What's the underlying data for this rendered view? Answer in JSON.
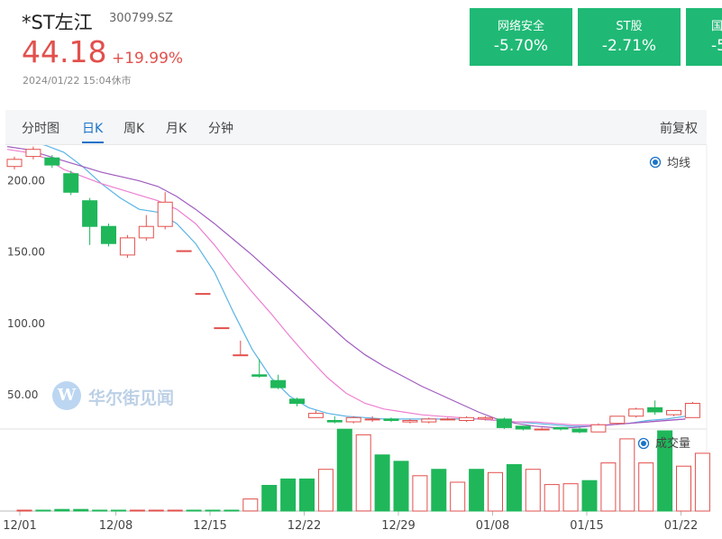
{
  "stock": {
    "name": "*ST左江",
    "code": "300799.SZ",
    "price": "44.18",
    "change": "+19.99%",
    "time": "2024/01/22 15:04休市"
  },
  "cards": [
    {
      "name": "网络安全",
      "value": "-5.70%"
    },
    {
      "name": "ST股",
      "value": "-2.71%"
    },
    {
      "name": "国",
      "value": "-5"
    }
  ],
  "tabs": [
    "分时图",
    "日K",
    "周K",
    "月K",
    "分钟"
  ],
  "active_tab": "日K",
  "adjust_label": "前复权",
  "watermark": {
    "logo": "W",
    "text": "华尔街见闻"
  },
  "colors": {
    "up": "#e2504c",
    "down": "#1fb75a",
    "card": "#1fb975",
    "accent": "#1a73c9",
    "ma1": "#5ab4e6",
    "ma2": "#ee7fd1",
    "ma3": "#a05cbf"
  },
  "chart_data": {
    "type": "candlestick",
    "legend": {
      "ma": "均线",
      "volume": "成交量"
    },
    "y_ticks": [
      "200.00",
      "150.00",
      "100.00",
      "50.00"
    ],
    "y_tick_values": [
      200,
      150,
      100,
      50
    ],
    "ylim": [
      26,
      225
    ],
    "x_ticks": [
      "12/01",
      "12/08",
      "12/15",
      "12/22",
      "12/29",
      "01/08",
      "01/15",
      "01/22"
    ],
    "x_tick_index": [
      0,
      5,
      10,
      15,
      20,
      25,
      30,
      35
    ],
    "candles": [
      {
        "o": 210,
        "c": 215,
        "h": 217,
        "l": 208
      },
      {
        "o": 217,
        "c": 222,
        "h": 224,
        "l": 215
      },
      {
        "o": 216,
        "c": 211,
        "h": 218,
        "l": 209
      },
      {
        "o": 205,
        "c": 192,
        "h": 207,
        "l": 190
      },
      {
        "o": 186,
        "c": 168,
        "h": 188,
        "l": 155
      },
      {
        "o": 168,
        "c": 156,
        "h": 170,
        "l": 154
      },
      {
        "o": 148,
        "c": 160,
        "h": 162,
        "l": 146
      },
      {
        "o": 160,
        "c": 168,
        "h": 176,
        "l": 158
      },
      {
        "o": 168,
        "c": 185,
        "h": 192,
        "l": 166
      },
      {
        "o": 151,
        "c": 151,
        "h": 151,
        "l": 151
      },
      {
        "o": 121,
        "c": 121,
        "h": 121,
        "l": 121
      },
      {
        "o": 97,
        "c": 97,
        "h": 97,
        "l": 97
      },
      {
        "o": 78,
        "c": 78,
        "h": 88,
        "l": 78
      },
      {
        "o": 64,
        "c": 63,
        "h": 75,
        "l": 62
      },
      {
        "o": 60,
        "c": 55,
        "h": 64,
        "l": 54
      },
      {
        "o": 47,
        "c": 44,
        "h": 48,
        "l": 42
      },
      {
        "o": 34,
        "c": 37,
        "h": 39,
        "l": 34
      },
      {
        "o": 32,
        "c": 31,
        "h": 35,
        "l": 30
      },
      {
        "o": 31,
        "c": 34,
        "h": 35,
        "l": 30
      },
      {
        "o": 33,
        "c": 33,
        "h": 35,
        "l": 31
      },
      {
        "o": 33,
        "c": 32,
        "h": 34,
        "l": 31
      },
      {
        "o": 31,
        "c": 32,
        "h": 33,
        "l": 30
      },
      {
        "o": 31,
        "c": 33,
        "h": 34,
        "l": 30
      },
      {
        "o": 33,
        "c": 33,
        "h": 34,
        "l": 32
      },
      {
        "o": 32,
        "c": 34,
        "h": 35,
        "l": 31
      },
      {
        "o": 33,
        "c": 34,
        "h": 35,
        "l": 32
      },
      {
        "o": 33,
        "c": 27,
        "h": 34,
        "l": 26
      },
      {
        "o": 28,
        "c": 26,
        "h": 28,
        "l": 25
      },
      {
        "o": 26,
        "c": 26,
        "h": 27,
        "l": 25
      },
      {
        "o": 27,
        "c": 26,
        "h": 27,
        "l": 25
      },
      {
        "o": 26,
        "c": 24,
        "h": 27,
        "l": 23
      },
      {
        "o": 24,
        "c": 29,
        "h": 30,
        "l": 24
      },
      {
        "o": 30,
        "c": 35,
        "h": 35,
        "l": 29
      },
      {
        "o": 35,
        "c": 40,
        "h": 41,
        "l": 34
      },
      {
        "o": 41,
        "c": 38,
        "h": 46,
        "l": 36
      },
      {
        "o": 36,
        "c": 39,
        "h": 39,
        "l": 35
      },
      {
        "o": 34,
        "c": 44,
        "h": 45,
        "l": 34
      }
    ],
    "ma_series": [
      {
        "values": [
          230,
          228,
          225,
          220,
          210,
          198,
          188,
          180,
          178,
          170,
          156,
          136,
          108,
          82,
          62,
          49,
          41,
          37,
          35,
          34,
          33,
          33,
          33,
          33,
          33,
          33,
          32,
          31,
          30,
          29,
          28,
          28,
          29,
          30,
          32,
          33,
          35
        ]
      },
      {
        "values": [
          222,
          220,
          216,
          208,
          203,
          198,
          194,
          190,
          186,
          180,
          170,
          155,
          138,
          122,
          107,
          91,
          76,
          62,
          51,
          44,
          40,
          38,
          36,
          35,
          34,
          33,
          32,
          31,
          31,
          30,
          29,
          29,
          29,
          30,
          31,
          32,
          33
        ]
      },
      {
        "values": [
          224,
          222,
          218,
          214,
          210,
          206,
          203,
          200,
          196,
          189,
          180,
          170,
          159,
          148,
          136,
          124,
          112,
          100,
          88,
          78,
          70,
          63,
          56,
          50,
          44,
          38,
          33,
          30,
          28,
          27,
          27,
          28,
          29,
          30,
          31,
          32,
          33
        ]
      }
    ],
    "volume": {
      "max": 100,
      "values": [
        1,
        1,
        2,
        2,
        1,
        0.5,
        0.4,
        0.4,
        0.3,
        0.2,
        0.3,
        0.3,
        15,
        32,
        40,
        40,
        52,
        102,
        95,
        70,
        62,
        44,
        52,
        36,
        52,
        48,
        58,
        52,
        33,
        34,
        38,
        60,
        90,
        60,
        100,
        56,
        72
      ],
      "up": [
        true,
        false,
        false,
        false,
        false,
        false,
        true,
        true,
        true,
        false,
        false,
        false,
        true,
        false,
        false,
        false,
        true,
        false,
        true,
        false,
        false,
        true,
        false,
        true,
        false,
        true,
        false,
        true,
        true,
        true,
        false,
        true,
        true,
        true,
        false,
        true,
        true
      ]
    }
  }
}
